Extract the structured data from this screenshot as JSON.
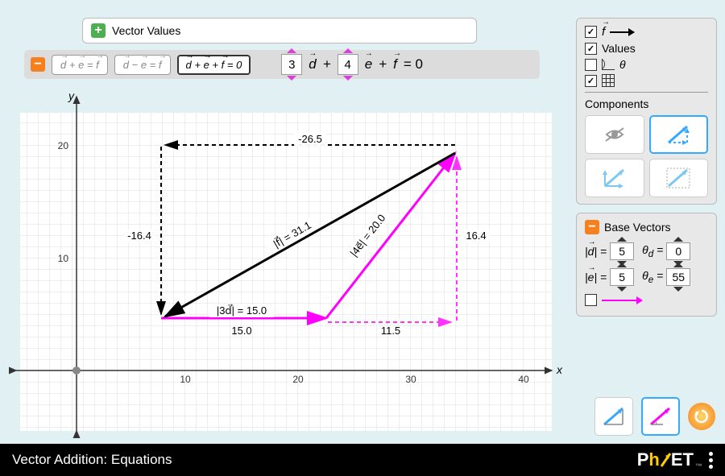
{
  "title": "Vector Addition: Equations",
  "vector_values_panel": {
    "label": "Vector Values",
    "expanded": false
  },
  "equation_bar": {
    "options": [
      {
        "label": "d⃗ + e⃗ = f⃗",
        "active": false
      },
      {
        "label": "d⃗ − e⃗ = f⃗",
        "active": false
      },
      {
        "label": "d⃗ + e⃗ + f⃗ = 0",
        "active": true
      }
    ],
    "coef_d": "3",
    "coef_e": "4",
    "plus1": "+",
    "plus2": "+",
    "eq_zero": "= 0",
    "d": "d",
    "e": "e",
    "f": "f"
  },
  "axes": {
    "x_label": "x",
    "y_label": "y",
    "x_ticks": [
      "10",
      "20",
      "30",
      "40"
    ],
    "y_ticks": [
      "10",
      "20"
    ]
  },
  "graph_labels": {
    "top_dx": "-26.5",
    "left_dy": "-16.4",
    "f_mag": "|f⃗| = 31.1",
    "e_mag": "|4e⃗| = 20.0",
    "d_mag": "|3d⃗| = 15.0",
    "bottom_dx1": "15.0",
    "bottom_dx2": "11.5",
    "right_dy": "16.4"
  },
  "display_options": {
    "f_vector": {
      "checked": true,
      "label": "f"
    },
    "values": {
      "checked": true,
      "label": "Values"
    },
    "angles": {
      "checked": false,
      "theta": "θ"
    },
    "grid": {
      "checked": true
    }
  },
  "components": {
    "title": "Components",
    "active_index": 1
  },
  "base_vectors": {
    "label": "Base Vectors",
    "d_mag": "5",
    "d_ang": "0",
    "e_mag": "5",
    "e_ang": "55",
    "d_mag_lbl": "|d⃗| =",
    "d_ang_lbl": "θ_d =",
    "e_mag_lbl": "|e⃗| =",
    "e_ang_lbl": "θ_e =",
    "show_base": false
  },
  "color_mode": {
    "active": "magenta"
  },
  "phet": "PhET"
}
